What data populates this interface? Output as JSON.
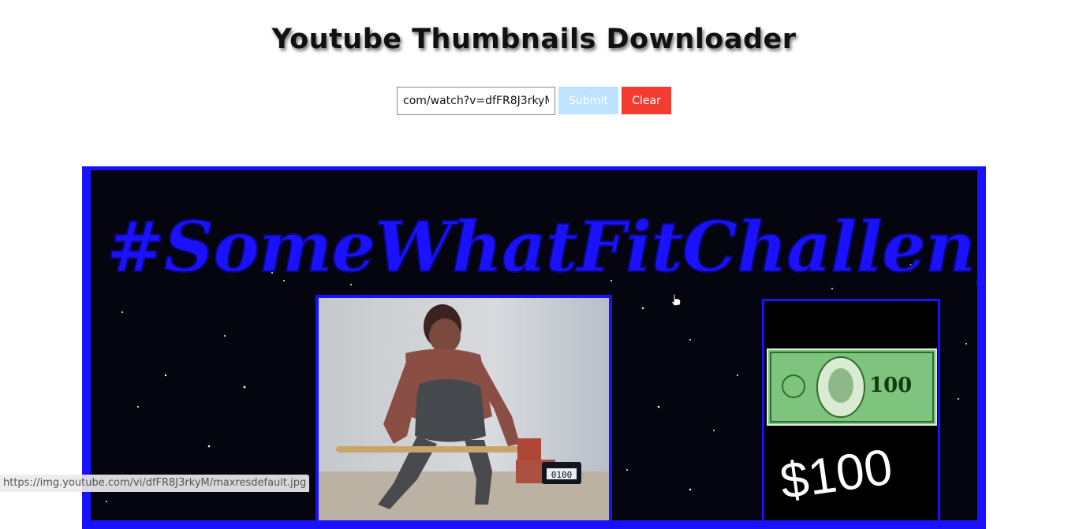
{
  "header": {
    "title": "Youtube Thumbnails Downloader"
  },
  "form": {
    "url_value": "com/watch?v=dfFR8J3rkyM",
    "submit_label": "Submit",
    "clear_label": "Clear"
  },
  "thumbnail": {
    "headline": "#SomeWhatFitChallenge",
    "bill_value": "100",
    "prize_text": "$100"
  },
  "status_bar": {
    "url": "https://img.youtube.com/vi/dfFR8J3rkyM/maxresdefault.jpg"
  },
  "colors": {
    "submit_bg": "#bfe2ff",
    "clear_bg": "#f33b2f",
    "thumb_border": "#1a12ff"
  }
}
